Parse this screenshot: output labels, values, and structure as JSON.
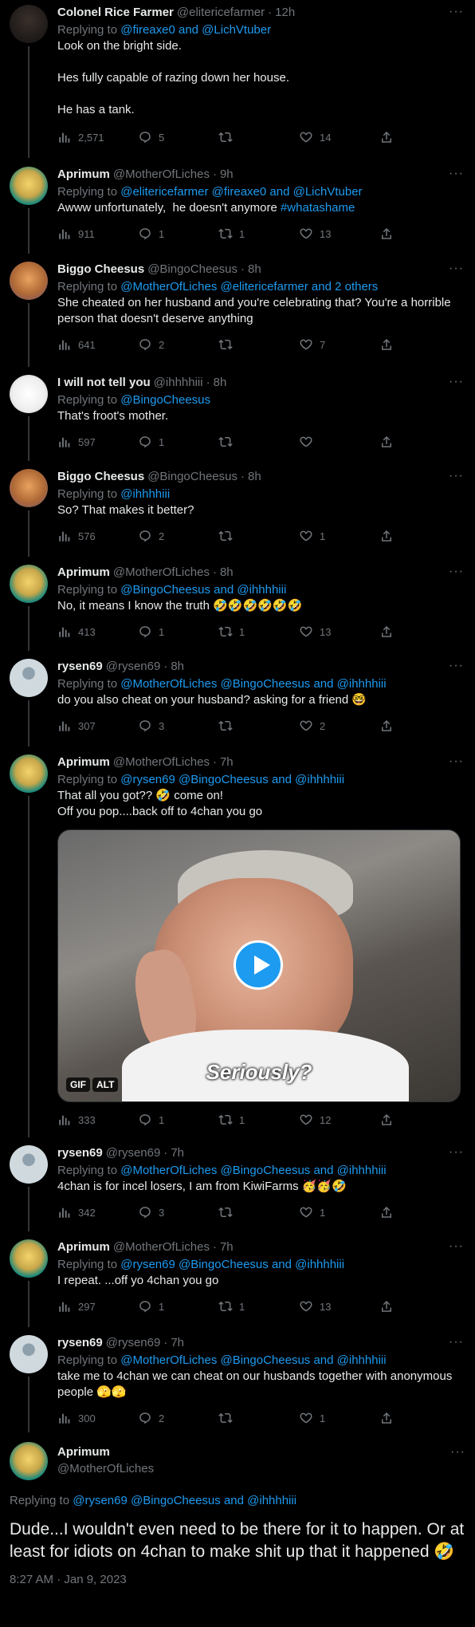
{
  "tweets": [
    {
      "name": "Colonel Rice Farmer",
      "handle": "@elitericefarmer",
      "time": "12h",
      "reply_prefix": "Replying to",
      "reply_to": "@fireaxe0 and @LichVtuber",
      "text": "Look on the bright side.\n\nHes fully capable of razing down her house.\n\nHe has a tank.",
      "views": "2,571",
      "replies": "5",
      "retweets": "",
      "likes": "14"
    },
    {
      "name": "Aprimum",
      "handle": "@MotherOfLiches",
      "time": "9h",
      "reply_prefix": "Replying to",
      "reply_to": "@elitericefarmer @fireaxe0 and @LichVtuber",
      "text": "Awww unfortunately,  he doesn't anymore ",
      "hashtag": "#whatashame",
      "views": "911",
      "replies": "1",
      "retweets": "1",
      "likes": "13"
    },
    {
      "name": "Biggo Cheesus",
      "handle": "@BingoCheesus",
      "time": "8h",
      "reply_prefix": "Replying to",
      "reply_to": "@MotherOfLiches @elitericefarmer and 2 others",
      "text": "She cheated on her husband and you're celebrating that? You're a horrible person that doesn't deserve anything",
      "views": "641",
      "replies": "2",
      "retweets": "",
      "likes": "7"
    },
    {
      "name": "I will not tell you",
      "handle": "@ihhhhiii",
      "time": "8h",
      "reply_prefix": "Replying to",
      "reply_to": "@BingoCheesus",
      "text": "That's froot's mother.",
      "views": "597",
      "replies": "1",
      "retweets": "",
      "likes": ""
    },
    {
      "name": "Biggo Cheesus",
      "handle": "@BingoCheesus",
      "time": "8h",
      "reply_prefix": "Replying to",
      "reply_to": "@ihhhhiii",
      "text": "So? That makes it better?",
      "views": "576",
      "replies": "2",
      "retweets": "",
      "likes": "1"
    },
    {
      "name": "Aprimum",
      "handle": "@MotherOfLiches",
      "time": "8h",
      "reply_prefix": "Replying to",
      "reply_to": "@BingoCheesus and @ihhhhiii",
      "text": "No, it means I know the truth 🤣🤣🤣🤣🤣🤣",
      "views": "413",
      "replies": "1",
      "retweets": "1",
      "likes": "13"
    },
    {
      "name": "rysen69",
      "handle": "@rysen69",
      "time": "8h",
      "reply_prefix": "Replying to",
      "reply_to": "@MotherOfLiches @BingoCheesus and @ihhhhiii",
      "text": "do you also cheat on your husband? asking for a friend 🤓",
      "views": "307",
      "replies": "3",
      "retweets": "",
      "likes": "2"
    },
    {
      "name": "Aprimum",
      "handle": "@MotherOfLiches",
      "time": "7h",
      "reply_prefix": "Replying to",
      "reply_to": "@rysen69 @BingoCheesus and @ihhhhiii",
      "text": "That all you got?? 🤣 come on!\nOff you pop....back off to 4chan you go",
      "gif_caption": "Seriously?",
      "gif_badge": "GIF",
      "alt_badge": "ALT",
      "views": "333",
      "replies": "1",
      "retweets": "1",
      "likes": "12"
    },
    {
      "name": "rysen69",
      "handle": "@rysen69",
      "time": "7h",
      "reply_prefix": "Replying to",
      "reply_to": "@MotherOfLiches @BingoCheesus and @ihhhhiii",
      "text": "4chan is for incel losers, I am from KiwiFarms 🥳🥳🤣",
      "views": "342",
      "replies": "3",
      "retweets": "",
      "likes": "1"
    },
    {
      "name": "Aprimum",
      "handle": "@MotherOfLiches",
      "time": "7h",
      "reply_prefix": "Replying to",
      "reply_to": "@rysen69 @BingoCheesus and @ihhhhiii",
      "text": "I repeat. ...off yo 4chan you go",
      "views": "297",
      "replies": "1",
      "retweets": "1",
      "likes": "13"
    },
    {
      "name": "rysen69",
      "handle": "@rysen69",
      "time": "7h",
      "reply_prefix": "Replying to",
      "reply_to": "@MotherOfLiches @BingoCheesus and @ihhhhiii",
      "text": "take me to 4chan we can cheat on our husbands together with anonymous people 🫣🫣",
      "views": "300",
      "replies": "2",
      "retweets": "",
      "likes": "1"
    }
  ],
  "main": {
    "name": "Aprimum",
    "handle": "@MotherOfLiches",
    "reply_prefix": "Replying to",
    "reply_to": "@rysen69 @BingoCheesus and @ihhhhiii",
    "text": "Dude...I wouldn't even need to be there for it to happen. Or at least for idiots on 4chan to make shit up that it happened 🤣",
    "timestamp": "8:27 AM · Jan 9, 2023"
  },
  "more_glyph": "···",
  "colors": {
    "background": "#000000",
    "text": "#e7e9ea",
    "muted": "#71767b",
    "link": "#1d9bf0"
  }
}
